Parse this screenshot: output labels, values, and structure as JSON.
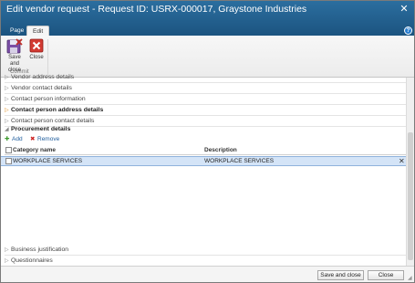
{
  "window": {
    "title": "Edit vendor request - Request ID: USRX-000017, Graystone Industries"
  },
  "ribbon": {
    "tabs": [
      {
        "label": "Page"
      },
      {
        "label": "Edit"
      }
    ],
    "save_and_close": {
      "line1": "Save and",
      "line2": "close"
    },
    "close_label": "Close",
    "group_label": "Commit"
  },
  "sections": {
    "clipped": "Vendor address details",
    "vendor_contact": "Vendor contact details",
    "contact_info": "Contact person information",
    "contact_address": "Contact person address details",
    "contact_contact": "Contact person contact details",
    "procurement": "Procurement details",
    "business": "Business justification",
    "questionnaires": "Questionnaires"
  },
  "procurement_grid": {
    "add_label": "Add",
    "remove_label": "Remove",
    "columns": [
      "Category name",
      "Description"
    ],
    "rows": [
      {
        "category": "WORKPLACE SERVICES",
        "description": "WORKPLACE SERVICES"
      }
    ]
  },
  "footer": {
    "save_and_close": "Save and close",
    "close": "Close"
  },
  "colors": {
    "titlebar": "#1f5a87",
    "selected_row": "#d4e4f7",
    "accent_orange": "#e08a1a"
  }
}
